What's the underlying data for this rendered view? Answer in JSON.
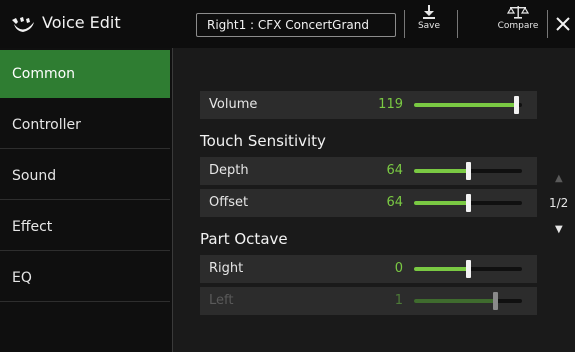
{
  "header": {
    "title": "Voice Edit",
    "voice_name": "Right1 : CFX ConcertGrand",
    "save_label": "Save",
    "compare_label": "Compare",
    "close_icon": "close-icon"
  },
  "sidebar": {
    "tabs": [
      {
        "label": "Common",
        "active": true
      },
      {
        "label": "Controller",
        "active": false
      },
      {
        "label": "Sound",
        "active": false
      },
      {
        "label": "Effect",
        "active": false
      },
      {
        "label": "EQ",
        "active": false
      }
    ]
  },
  "main": {
    "volume": {
      "label": "Volume",
      "value": "119",
      "level": 0.94
    },
    "touch_sensitivity": {
      "title": "Touch Sensitivity",
      "depth": {
        "label": "Depth",
        "value": "64",
        "level": 0.5
      },
      "offset": {
        "label": "Offset",
        "value": "64",
        "level": 0.5
      }
    },
    "part_octave": {
      "title": "Part Octave",
      "right": {
        "label": "Right",
        "value": "0",
        "level": 0.5
      },
      "left": {
        "label": "Left",
        "value": "1",
        "level": 0.75,
        "disabled": true
      }
    }
  },
  "pager": {
    "page": "1/2"
  },
  "colors": {
    "accent_green": "#7ac943",
    "active_tab": "#2f7d32"
  }
}
